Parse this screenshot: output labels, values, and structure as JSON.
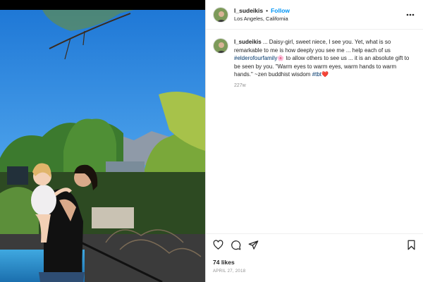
{
  "post": {
    "username": "l_sudeikis",
    "follow_label": "Follow",
    "separator": "•",
    "location": "Los Angeles, California",
    "caption": {
      "text_main": " ... Daisy-girl, sweet niece, I see you. Yet, what is so remarkable to me is how deeply you see me ... help each of us ",
      "hashtag_1": "#elderofourfamily",
      "emoji_1": "🌸",
      "text_mid": " to allow others to see us ... it is an absolute gift to be seen by you. \"Warm eyes to warm eyes, warm hands to warm hands.\" ~zen buddhist wisdom ",
      "hashtag_2": "#tbt",
      "emoji_2": "❤️"
    },
    "time_ago": "227w",
    "likes": "74 likes",
    "date": "APRIL 27, 2018"
  },
  "icons": {
    "more": "more-options-icon",
    "like": "heart-icon",
    "comment": "comment-icon",
    "share": "share-icon",
    "save": "bookmark-icon"
  },
  "colors": {
    "follow": "#0095f6",
    "hashtag": "#00376b",
    "muted": "#8e8e8e",
    "text": "#262626"
  }
}
